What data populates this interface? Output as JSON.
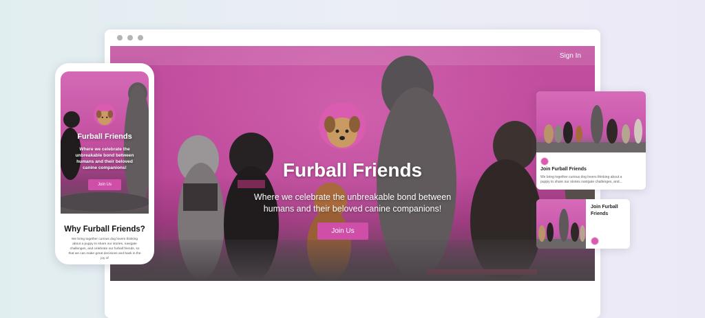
{
  "desktop": {
    "nav": {
      "signin_label": "Sign In"
    },
    "hero": {
      "title": "Furball Friends",
      "subtitle_line1": "Where we celebrate the unbreakable bond between",
      "subtitle_line2": "humans and their beloved canine companions!",
      "cta_label": "Join Us"
    }
  },
  "phone": {
    "hero": {
      "title": "Furball Friends",
      "subtitle_line1": "Where we celebrate the",
      "subtitle_line2": "unbreakable bond between",
      "subtitle_line3": "humans and their beloved",
      "subtitle_line4": "canine companions!",
      "cta_label": "Join Us"
    },
    "section": {
      "title": "Why Furball Friends?",
      "text": "We bring together curious dog lovers thinking about a puppy to share our stories, navigate challenges, and celebrate our furball friends, so that we can make great decisions and bask in the joy of"
    }
  },
  "cards": [
    {
      "title": "Join Furball Friends",
      "text_line1": "We bring together curious dog lovers thinking about a",
      "text_line2": "puppy to share our stories navigate challenges, and..."
    },
    {
      "title_line1": "Join Furball",
      "title_line2": "Friends"
    }
  ],
  "colors": {
    "brand_pink": "#cf4fa8",
    "wall_pink": "#c24fa0",
    "text_white": "#ffffff"
  }
}
